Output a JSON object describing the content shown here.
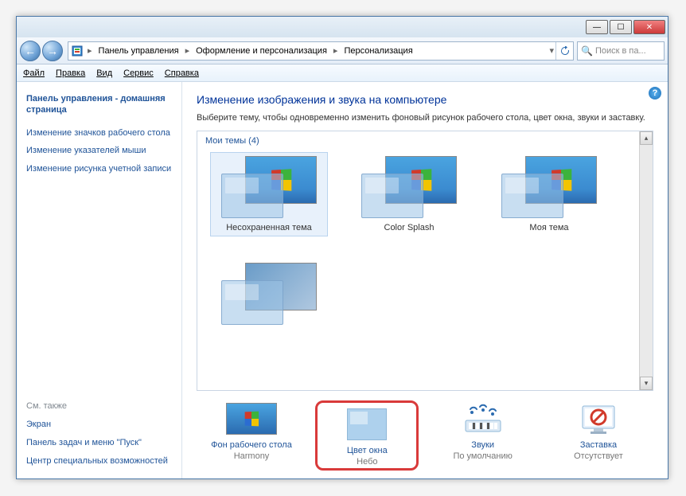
{
  "titlebar": {
    "min": "—",
    "max": "☐",
    "close": "✕"
  },
  "breadcrumb": {
    "root_icon": "control-panel",
    "items": [
      "Панель управления",
      "Оформление и персонализация",
      "Персонализация"
    ]
  },
  "search": {
    "placeholder": "Поиск в па..."
  },
  "menubar": {
    "file": "Файл",
    "edit": "Правка",
    "view": "Вид",
    "tools": "Сервис",
    "help": "Справка"
  },
  "sidebar": {
    "home": "Панель управления - домашняя страница",
    "links": [
      "Изменение значков рабочего стола",
      "Изменение указателей мыши",
      "Изменение рисунка учетной записи"
    ],
    "seealso_header": "См. также",
    "seealso": [
      "Экран",
      "Панель задач и меню \"Пуск\"",
      "Центр специальных возможностей"
    ]
  },
  "main": {
    "heading": "Изменение изображения и звука на компьютере",
    "subtext": "Выберите тему, чтобы одновременно изменить фоновый рисунок рабочего стола, цвет окна, звуки и заставку.",
    "group_label": "Мои темы (4)",
    "themes": [
      {
        "label": "Несохраненная тема",
        "selected": true,
        "multi": false
      },
      {
        "label": "Color Splash",
        "selected": false,
        "multi": true
      },
      {
        "label": "Моя тема",
        "selected": false,
        "multi": false
      },
      {
        "label": "",
        "selected": false,
        "multi": true
      }
    ]
  },
  "bottom": {
    "items": [
      {
        "id": "desktop-bg",
        "label": "Фон рабочего стола",
        "value": "Harmony"
      },
      {
        "id": "window-color",
        "label": "Цвет окна",
        "value": "Небо",
        "highlight": true
      },
      {
        "id": "sounds",
        "label": "Звуки",
        "value": "По умолчанию"
      },
      {
        "id": "screensaver",
        "label": "Заставка",
        "value": "Отсутствует"
      }
    ]
  }
}
